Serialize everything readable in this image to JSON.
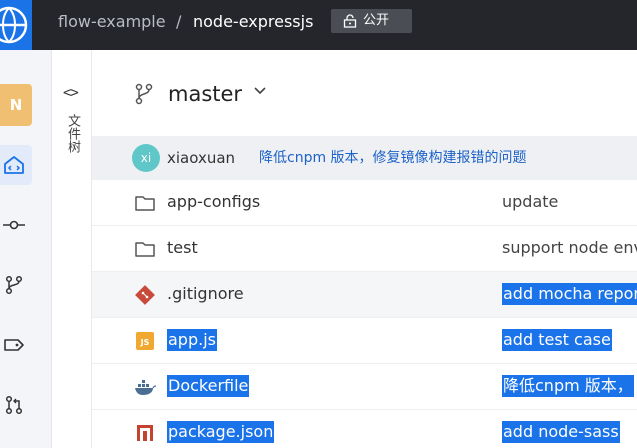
{
  "header": {
    "owner": "flow-example",
    "separator": "/",
    "repo": "node-expressjs",
    "visibility": "公开"
  },
  "leftnav": {
    "avatar_letter": "N",
    "items": [
      {
        "icon": "code-home-icon",
        "active": true
      },
      {
        "icon": "commit-icon"
      },
      {
        "icon": "branch-icon"
      },
      {
        "icon": "tag-icon"
      },
      {
        "icon": "merge-request-icon"
      }
    ]
  },
  "tree": {
    "toggle": "<>",
    "label": "文件树"
  },
  "branch": {
    "name": "master"
  },
  "commit": {
    "avatar_text": "xi",
    "author": "xiaoxuan",
    "message": "降低cnpm 版本，修复镜像构建报错的问题"
  },
  "files": [
    {
      "name": "app-configs",
      "type": "folder",
      "message": "update"
    },
    {
      "name": "test",
      "type": "folder",
      "message": "support node env"
    },
    {
      "name": ".gitignore",
      "type": "git",
      "message": "add mocha report"
    },
    {
      "name": "app.js",
      "type": "js",
      "message": "add test case"
    },
    {
      "name": "Dockerfile",
      "type": "docker",
      "message": "降低cnpm 版本，"
    },
    {
      "name": "package.json",
      "type": "npm",
      "message": "add node-sass"
    }
  ],
  "colors": {
    "header_bg": "#24262b",
    "selection": "#1a73e8",
    "commit_link": "#1d62c9",
    "avatar": "#5fc7c8"
  }
}
